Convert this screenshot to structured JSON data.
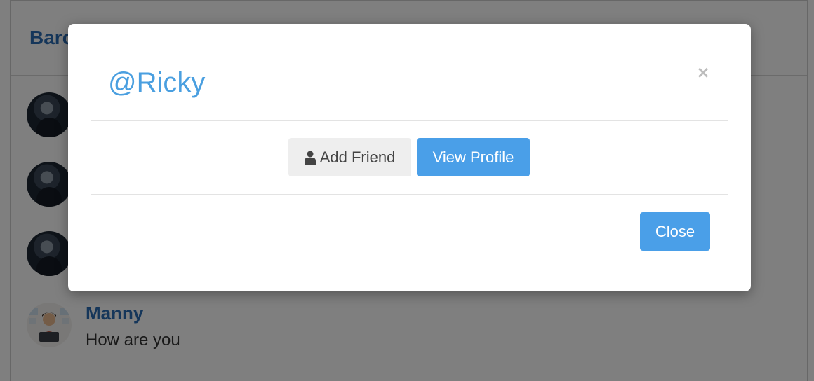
{
  "background": {
    "page_title": "Barc",
    "messages": [
      {
        "name": "",
        "text": "",
        "avatar": "dark-portrait"
      },
      {
        "name": "",
        "text": "",
        "avatar": "dark-portrait"
      },
      {
        "name": "",
        "text": "",
        "avatar": "dark-portrait"
      },
      {
        "name": "Manny",
        "text": "How are you",
        "avatar": "cartoon-person"
      }
    ]
  },
  "modal": {
    "title": "@Ricky",
    "close_x": "×",
    "add_friend_label": "Add Friend",
    "add_friend_icon": "user-icon",
    "view_profile_label": "View Profile",
    "close_label": "Close"
  },
  "colors": {
    "accent": "#4a9fe8",
    "title_blue": "#4a9fe0",
    "name_blue": "#2a6db5"
  }
}
